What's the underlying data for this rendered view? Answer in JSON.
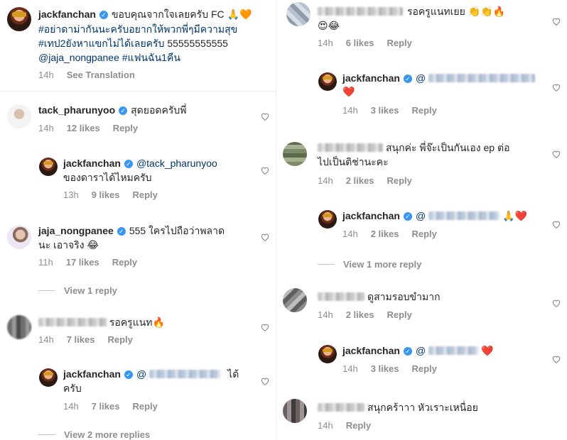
{
  "left": {
    "caption": {
      "username": "jackfanchan",
      "lines": [
        "ขอบคุณจากใจเลยครับ FC 🙏🧡",
        "#อย่าดาม่ากันนะครับอยากให้พวกพี่ๆมีความสุข",
        "#เทป2ยังหาแขกไม่ได้เลยครับ 55555555555",
        "@jaja_nongpanee #แฟนฉัน1คืน"
      ],
      "line1_text": "ขอบคุณจากใจเลยครับ FC",
      "line1_emoji": "🙏🧡",
      "line2": "#อย่าดาม่ากันนะครับอยากให้พวกพี่ๆมีความสุข",
      "line3": "#เทป2ยังหาแขกไม่ได้เลยครับ",
      "line3_num": "55555555555",
      "line4_mention": "@jaja_nongpanee",
      "line4_tag": "#แฟนฉัน1คืน",
      "time": "14h",
      "see_translation": "See Translation"
    },
    "c1": {
      "username": "tack_pharunyoo",
      "text": "สุดยอดครับพี่",
      "time": "14h",
      "likes": "12 likes",
      "reply": "Reply"
    },
    "c1r": {
      "username": "jackfanchan",
      "mention": "@tack_pharunyoo",
      "text": "ของดาราได้ไหมครับ",
      "time": "13h",
      "likes": "9 likes",
      "reply": "Reply"
    },
    "c2": {
      "username": "jaja_nongpanee",
      "text1": "555 ใครไปถือว่าพลาด",
      "text2": "นะ เอาจริง",
      "emoji": "😂",
      "time": "11h",
      "likes": "17 likes",
      "reply": "Reply",
      "view_replies": "View 1 reply"
    },
    "c3": {
      "text": "รอครูแนท",
      "emoji": "🔥",
      "time": "14h",
      "likes": "7 likes",
      "reply": "Reply"
    },
    "c3r": {
      "username": "jackfanchan",
      "text_after": "ได้",
      "text2": "ครับ",
      "time": "14h",
      "likes": "7 likes",
      "reply": "Reply",
      "view_replies": "View 2 more replies"
    }
  },
  "right": {
    "r1": {
      "text": "รอครูแนทเยย",
      "emoji1": "👏👏🔥",
      "emoji2": "😍😂",
      "time": "14h",
      "likes": "6 likes",
      "reply": "Reply"
    },
    "r1r": {
      "username": "jackfanchan",
      "mention": "@",
      "emoji": "❤️",
      "time": "14h",
      "likes": "3 likes",
      "reply": "Reply"
    },
    "r2": {
      "text1": "สนุกค่ะ พี่จ๊ะเป็นกันเอง ep ต่อ",
      "text2": "ไปเป็นติช่านะคะ",
      "time": "14h",
      "likes": "2 likes",
      "reply": "Reply"
    },
    "r2r": {
      "username": "jackfanchan",
      "mention": "@",
      "emoji": "🙏❤️",
      "time": "14h",
      "likes": "2 likes",
      "reply": "Reply",
      "view_replies": "View 1 more reply"
    },
    "r3": {
      "text": "ดูสามรอบขำมาก",
      "time": "14h",
      "likes": "2 likes",
      "reply": "Reply"
    },
    "r3r": {
      "username": "jackfanchan",
      "mention": "@",
      "emoji": "❤️",
      "time": "14h",
      "likes": "3 likes",
      "reply": "Reply"
    },
    "r4": {
      "text": "สนุกคร้าาา หัวเราะเหนื่อย",
      "time": "14h",
      "reply": "Reply"
    }
  },
  "icons": {
    "verified": "verified-badge-icon",
    "like": "heart-outline-icon"
  },
  "colors": {
    "link": "#00376b",
    "verified": "#3897f0",
    "meta": "#8e8e8e",
    "heart_red": "#ed4956"
  }
}
